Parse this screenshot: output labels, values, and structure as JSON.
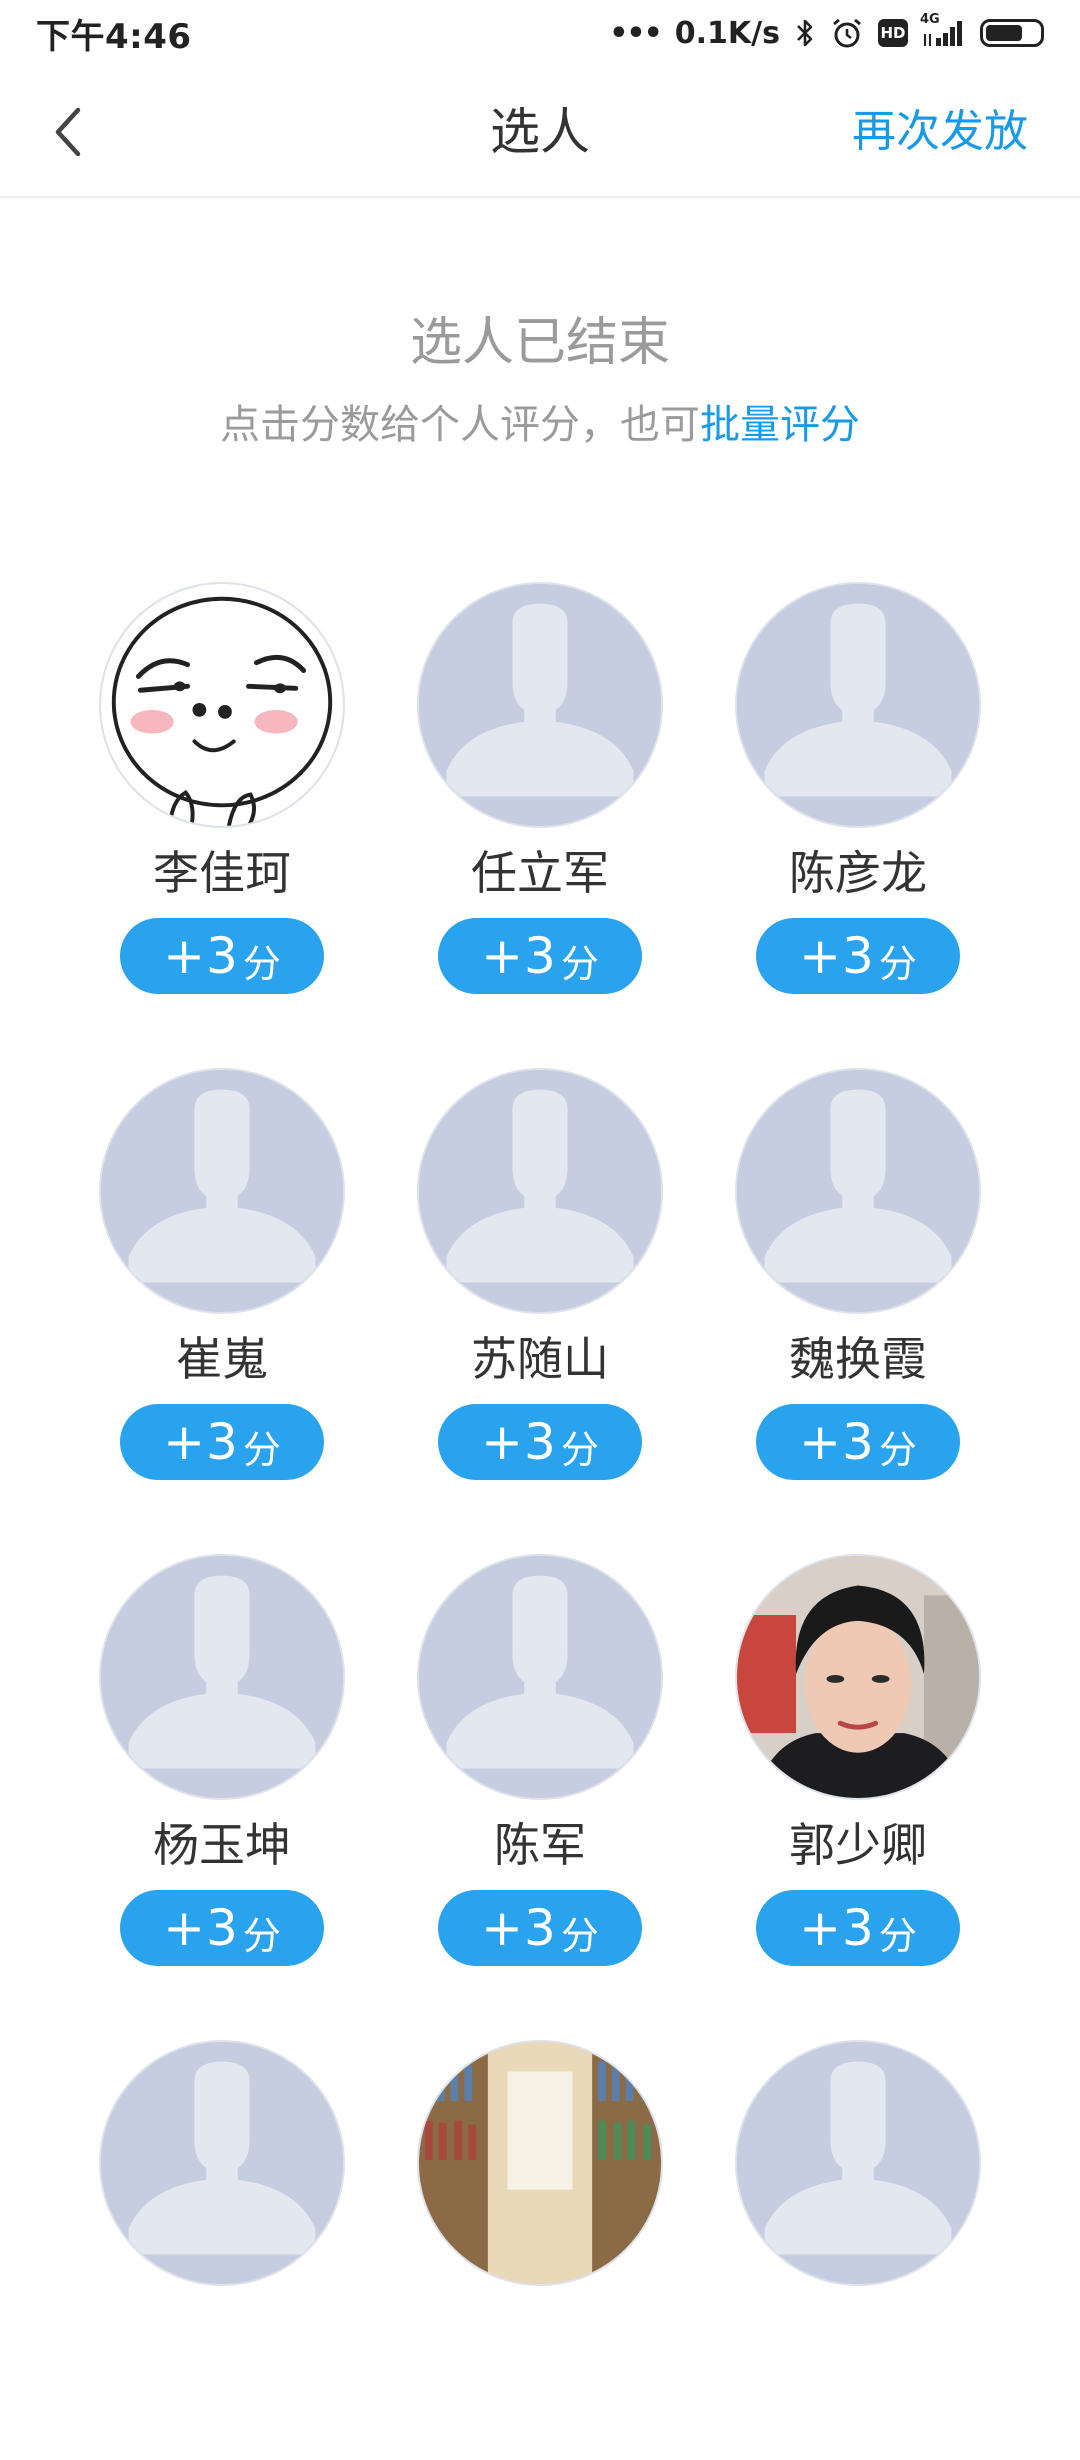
{
  "status_bar": {
    "time": "下午4:46",
    "speed": "0.1K/s",
    "network": "4G",
    "hd": "HD"
  },
  "nav": {
    "title": "选人",
    "action": "再次发放"
  },
  "notice": {
    "title": "选人已结束",
    "subtitle": "点击分数给个人评分，也可",
    "link": "批量评分"
  },
  "people": [
    {
      "name": "李佳珂",
      "score": "+3",
      "unit": "分",
      "avatar": "emoji-face"
    },
    {
      "name": "任立军",
      "score": "+3",
      "unit": "分",
      "avatar": "default-person"
    },
    {
      "name": "陈彦龙",
      "score": "+3",
      "unit": "分",
      "avatar": "default-person"
    },
    {
      "name": "崔嵬",
      "score": "+3",
      "unit": "分",
      "avatar": "default-person"
    },
    {
      "name": "苏随山",
      "score": "+3",
      "unit": "分",
      "avatar": "default-person"
    },
    {
      "name": "魏换霞",
      "score": "+3",
      "unit": "分",
      "avatar": "default-person"
    },
    {
      "name": "杨玉坤",
      "score": "+3",
      "unit": "分",
      "avatar": "default-person"
    },
    {
      "name": "陈军",
      "score": "+3",
      "unit": "分",
      "avatar": "default-person"
    },
    {
      "name": "郭少卿",
      "score": "+3",
      "unit": "分",
      "avatar": "photo-portrait"
    },
    {
      "name": "",
      "score": "",
      "unit": "",
      "avatar": "default-person"
    },
    {
      "name": "",
      "score": "",
      "unit": "",
      "avatar": "photo-bookshelf"
    },
    {
      "name": "",
      "score": "",
      "unit": "",
      "avatar": "default-person"
    }
  ],
  "colors": {
    "accent": "#1a9ae6",
    "button": "#2aa3ef",
    "placeholder_bg": "#c6cde0",
    "placeholder_fg": "#e3e7f0"
  }
}
